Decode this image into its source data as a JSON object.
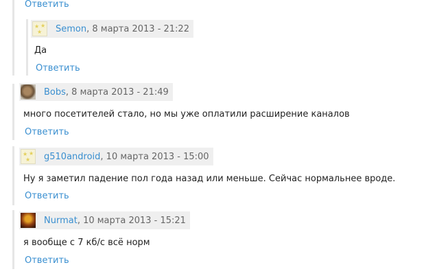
{
  "comments": [
    {
      "author": "",
      "date": "",
      "text": "",
      "reply_label": "Ответить"
    },
    {
      "author": "Semon",
      "date": ", 8 марта 2013 - 21:22",
      "text": "Да",
      "reply_label": "Ответить",
      "avatar": "default-avatar"
    },
    {
      "author": "Bobs",
      "date": ", 8 марта 2013 - 21:49",
      "text": "много посетителей стало, но мы уже оплатили расширение каналов",
      "reply_label": "Ответить",
      "avatar": "photo-avatar"
    },
    {
      "author": "g510android",
      "date": ", 10 марта 2013 - 15:00",
      "text": "Ну я заметил падение пол года назад или меньше. Сейчас нормальнее вроде.",
      "reply_label": "Ответить",
      "avatar": "default-avatar"
    },
    {
      "author": "Nurmat",
      "date": ", 10 марта 2013 - 15:21",
      "text": "я вообще с 7 кб/с всё норм",
      "reply_label": "Ответить",
      "avatar": "photo-avatar"
    }
  ],
  "colors": {
    "link": "#3a8fd0",
    "header_bg": "#efefef",
    "thread_line": "#e6e6e6"
  }
}
